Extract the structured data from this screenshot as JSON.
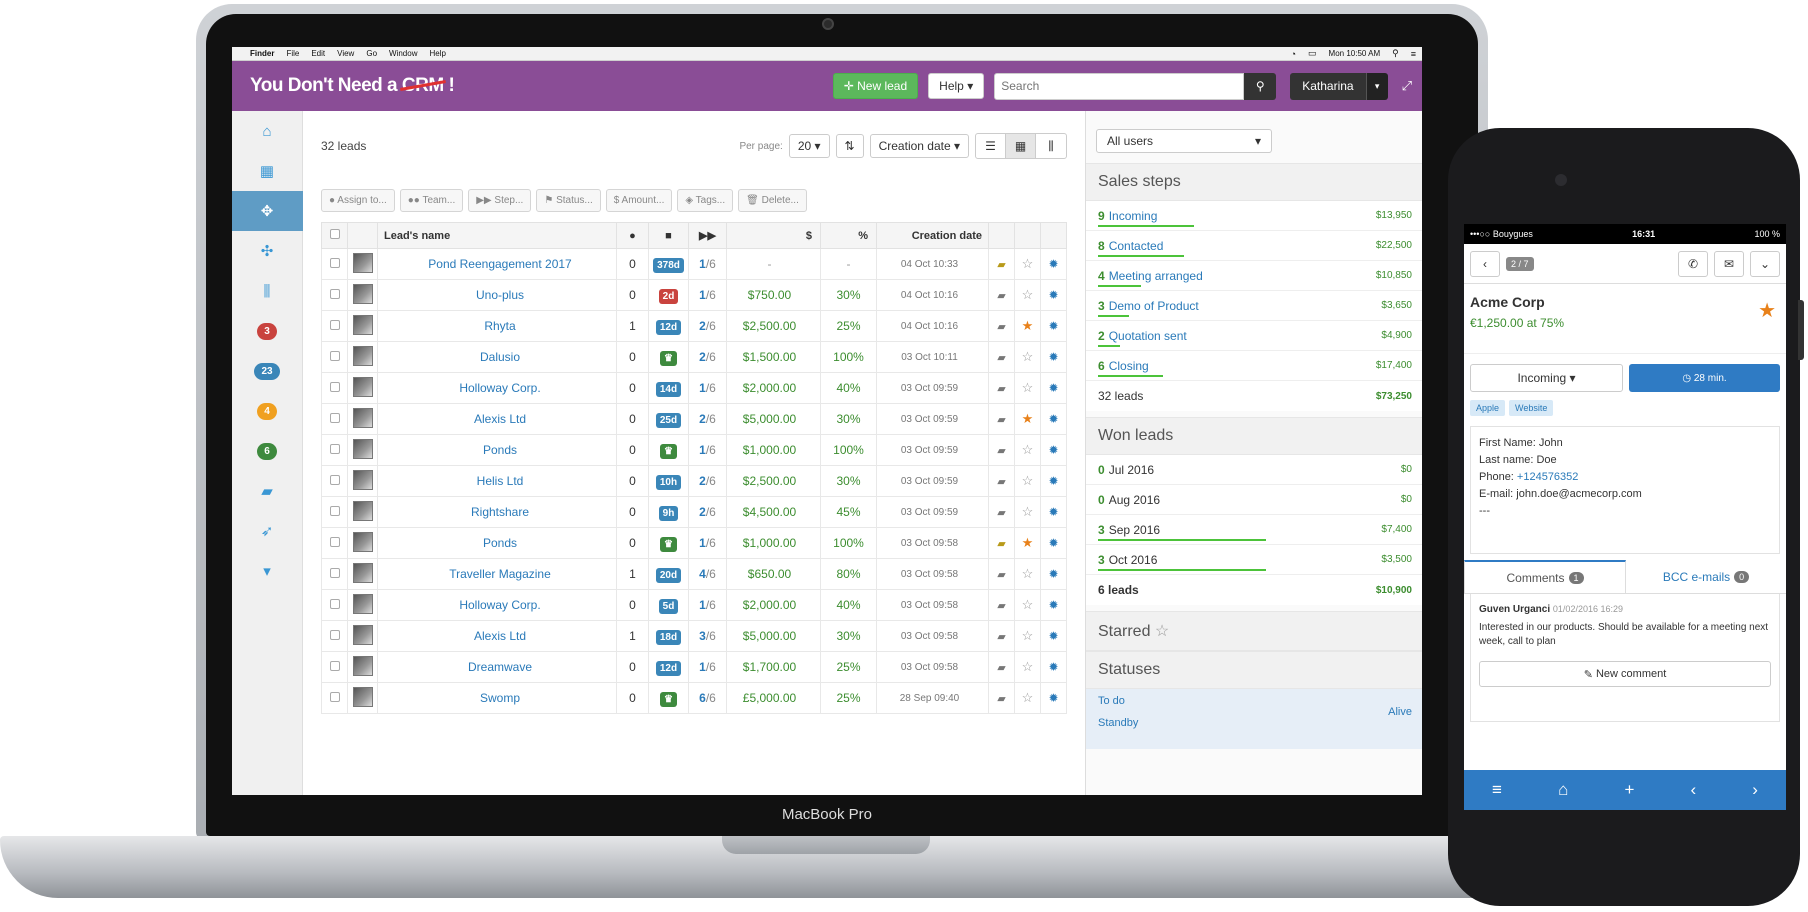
{
  "macos_menubar": {
    "items": [
      "Finder",
      "File",
      "Edit",
      "View",
      "Go",
      "Window",
      "Help"
    ],
    "clock": "Mon 10:50 AM"
  },
  "laptop_label": "MacBook Pro",
  "app": {
    "brand_prefix": "You Don't Need a ",
    "brand_crossed": "CRM",
    "brand_suffix": " !",
    "new_lead_label": "New lead",
    "help_label": "Help",
    "search_placeholder": "Search",
    "user_name": "Katharina"
  },
  "leftnav": {
    "badges": [
      {
        "value": "3",
        "color": "#c9433e"
      },
      {
        "value": "23",
        "color": "#3a86b8"
      },
      {
        "value": "4",
        "color": "#f0a020"
      },
      {
        "value": "6",
        "color": "#3e8a3e"
      }
    ]
  },
  "list": {
    "count_label": "32 leads",
    "per_page_label": "Per page:",
    "per_page_value": "20",
    "sort_value": "Creation date",
    "bulk_actions": [
      "Assign to...",
      "Team...",
      "Step...",
      "Status...",
      "Amount...",
      "Tags...",
      "Delete..."
    ],
    "columns": {
      "name": "Lead's name",
      "amount": "$",
      "pct": "%",
      "date": "Creation date"
    },
    "rows": [
      {
        "name": "Pond Reengagement 2017",
        "comments": "0",
        "age": "378d",
        "age_color": "blue",
        "step": "1",
        "total": "/6",
        "amount": "-",
        "pct": "-",
        "date": "04 Oct 10:33",
        "folder": "yellow",
        "starred": false
      },
      {
        "name": "Uno-plus",
        "comments": "0",
        "age": "2d",
        "age_color": "red",
        "step": "1",
        "total": "/6",
        "amount": "$750.00",
        "pct": "30%",
        "date": "04 Oct 10:16",
        "folder": "grey",
        "starred": false
      },
      {
        "name": "Rhyta",
        "comments": "1",
        "age": "12d",
        "age_color": "blue",
        "step": "2",
        "total": "/6",
        "amount": "$2,500.00",
        "pct": "25%",
        "date": "04 Oct 10:16",
        "folder": "grey",
        "starred": true
      },
      {
        "name": "Dalusio",
        "comments": "0",
        "age": "trophy",
        "age_color": "green",
        "step": "2",
        "total": "/6",
        "amount": "$1,500.00",
        "pct": "100%",
        "date": "03 Oct 10:11",
        "folder": "grey",
        "starred": false
      },
      {
        "name": "Holloway Corp.",
        "comments": "0",
        "age": "14d",
        "age_color": "blue",
        "step": "1",
        "total": "/6",
        "amount": "$2,000.00",
        "pct": "40%",
        "date": "03 Oct 09:59",
        "folder": "grey",
        "starred": false
      },
      {
        "name": "Alexis Ltd",
        "comments": "0",
        "age": "25d",
        "age_color": "blue",
        "step": "2",
        "total": "/6",
        "amount": "$5,000.00",
        "pct": "30%",
        "date": "03 Oct 09:59",
        "folder": "grey",
        "starred": true
      },
      {
        "name": "Ponds",
        "comments": "0",
        "age": "trophy",
        "age_color": "green",
        "step": "1",
        "total": "/6",
        "amount": "$1,000.00",
        "pct": "100%",
        "date": "03 Oct 09:59",
        "folder": "grey",
        "starred": false
      },
      {
        "name": "Helis Ltd",
        "comments": "0",
        "age": "10h",
        "age_color": "blue",
        "step": "2",
        "total": "/6",
        "amount": "$2,500.00",
        "pct": "30%",
        "date": "03 Oct 09:59",
        "folder": "grey",
        "starred": false
      },
      {
        "name": "Rightshare",
        "comments": "0",
        "age": "9h",
        "age_color": "blue",
        "step": "2",
        "total": "/6",
        "amount": "$4,500.00",
        "pct": "45%",
        "date": "03 Oct 09:59",
        "folder": "grey",
        "starred": false
      },
      {
        "name": "Ponds",
        "comments": "0",
        "age": "trophy",
        "age_color": "green",
        "step": "1",
        "total": "/6",
        "amount": "$1,000.00",
        "pct": "100%",
        "date": "03 Oct 09:58",
        "folder": "yellow",
        "starred": true
      },
      {
        "name": "Traveller Magazine",
        "comments": "1",
        "age": "20d",
        "age_color": "blue",
        "step": "4",
        "total": "/6",
        "amount": "$650.00",
        "pct": "80%",
        "date": "03 Oct 09:58",
        "folder": "grey",
        "starred": false
      },
      {
        "name": "Holloway Corp.",
        "comments": "0",
        "age": "5d",
        "age_color": "blue",
        "step": "1",
        "total": "/6",
        "amount": "$2,000.00",
        "pct": "40%",
        "date": "03 Oct 09:58",
        "folder": "grey",
        "starred": false
      },
      {
        "name": "Alexis Ltd",
        "comments": "1",
        "age": "18d",
        "age_color": "blue",
        "step": "3",
        "total": "/6",
        "amount": "$5,000.00",
        "pct": "30%",
        "date": "03 Oct 09:58",
        "folder": "grey",
        "starred": false
      },
      {
        "name": "Dreamwave",
        "comments": "0",
        "age": "12d",
        "age_color": "blue",
        "step": "1",
        "total": "/6",
        "amount": "$1,700.00",
        "pct": "25%",
        "date": "03 Oct 09:58",
        "folder": "grey",
        "starred": false
      },
      {
        "name": "Swomp",
        "comments": "0",
        "age": "trophy",
        "age_color": "green",
        "step": "6",
        "total": "/6",
        "amount": "£5,000.00",
        "pct": "25%",
        "date": "28 Sep 09:40",
        "folder": "grey",
        "starred": false
      }
    ]
  },
  "sidebar": {
    "users_filter": "All users",
    "sales_steps_title": "Sales steps",
    "sales_steps": [
      {
        "count": "9",
        "label": "Incoming",
        "value": "$13,950",
        "fill": 0.4
      },
      {
        "count": "8",
        "label": "Contacted",
        "value": "$22,500",
        "fill": 0.36
      },
      {
        "count": "4",
        "label": "Meeting arranged",
        "value": "$10,850",
        "fill": 0.18
      },
      {
        "count": "3",
        "label": "Demo of Product",
        "value": "$3,650",
        "fill": 0.13
      },
      {
        "count": "2",
        "label": "Quotation sent",
        "value": "$4,900",
        "fill": 0.09
      },
      {
        "count": "6",
        "label": "Closing",
        "value": "$17,400",
        "fill": 0.27
      }
    ],
    "sales_total": {
      "label": "32 leads",
      "value": "$73,250"
    },
    "won_title": "Won leads",
    "won": [
      {
        "count": "0",
        "label": "Jul 2016",
        "value": "$0",
        "fill": 0
      },
      {
        "count": "0",
        "label": "Aug 2016",
        "value": "$0",
        "fill": 0
      },
      {
        "count": "3",
        "label": "Sep 2016",
        "value": "$7,400",
        "fill": 0.7
      },
      {
        "count": "3",
        "label": "Oct 2016",
        "value": "$3,500",
        "fill": 0.7
      }
    ],
    "won_total": {
      "label": "6 leads",
      "value": "$10,900"
    },
    "starred_title": "Starred",
    "statuses_title": "Statuses",
    "statuses": [
      "To do",
      "Standby"
    ],
    "status_alive": "Alive"
  },
  "phone": {
    "carrier": "•••○○ Bouygues",
    "time": "16:31",
    "battery": "100 %",
    "position": "2 / 7",
    "lead_title": "Acme Corp",
    "lead_sub": "€1,250.00 at 75%",
    "step_label": "Incoming",
    "timer_label": "28 min.",
    "tags": [
      "Apple",
      "Website"
    ],
    "info": {
      "first_name": "First Name: John",
      "last_name": "Last name: Doe",
      "phone_label": "Phone: ",
      "phone_value": "+124576352",
      "email": "E-mail: john.doe@acmecorp.com",
      "extra": "---"
    },
    "tab_comments": "Comments",
    "tab_comments_count": "1",
    "tab_bcc": "BCC e-mails",
    "tab_bcc_count": "0",
    "comment_author": "Guven Urganci",
    "comment_time": "01/02/2016 16:29",
    "comment_text": "Interested in our products. Should be available for a meeting next week, call to plan",
    "new_comment_label": "New comment"
  }
}
